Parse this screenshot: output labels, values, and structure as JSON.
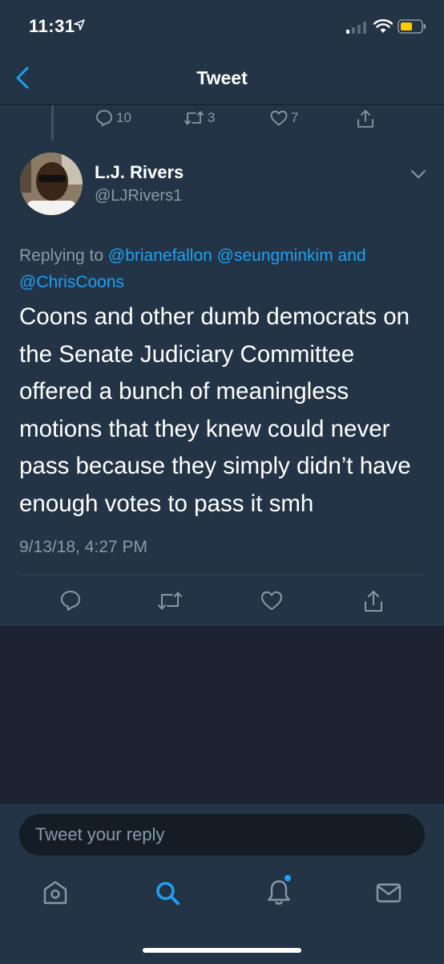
{
  "status_bar": {
    "time": "11:31"
  },
  "nav": {
    "title": "Tweet"
  },
  "previous_tweet": {
    "replies": "10",
    "retweets": "3",
    "likes": "7"
  },
  "tweet": {
    "author_name": "L.J. Rivers",
    "author_handle": "@LJRivers1",
    "replying_prefix": "Replying to",
    "replying_to": [
      "@brianefallon",
      "@seungminkim"
    ],
    "replying_and": "and",
    "replying_last": "@ChrisCoons",
    "text": "Coons and other dumb democrats on the Senate Judiciary Committee offered a bunch of meaningless motions that they knew could never pass because they simply didn’t have enough votes to pass it smh",
    "timestamp": "9/13/18, 4:27 PM"
  },
  "reply_box": {
    "placeholder": "Tweet your reply"
  },
  "tab_bar": [
    "home-icon",
    "search-icon",
    "notifications-icon",
    "messages-icon"
  ],
  "colors": {
    "accent": "#1da1f2",
    "background": "#243447",
    "muted": "#8899a6"
  }
}
